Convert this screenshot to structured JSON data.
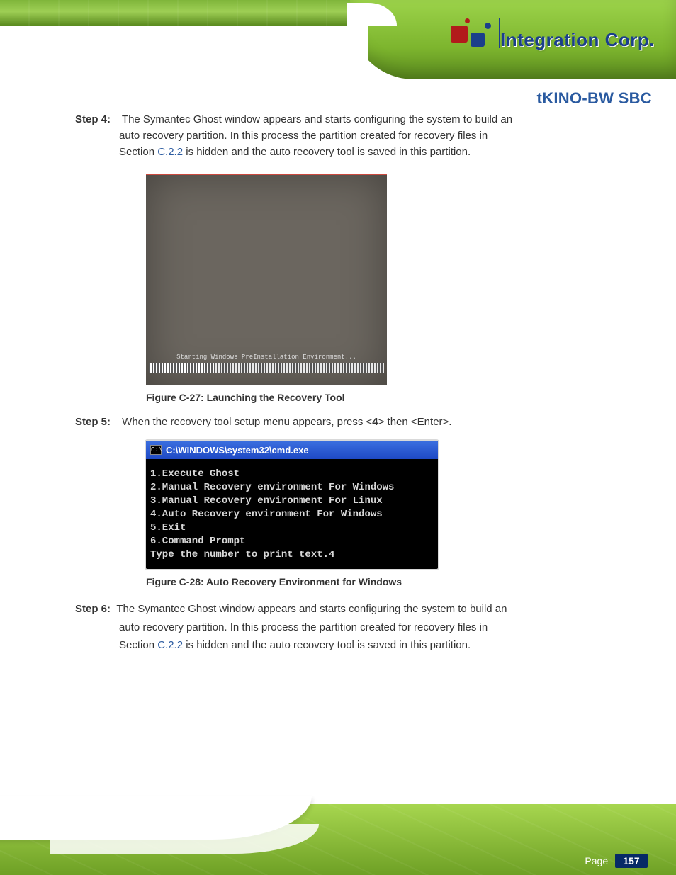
{
  "brand": {
    "name": "Integration Corp."
  },
  "product_label": "tKINO-BW SBC",
  "step4": {
    "no": "Step 4:",
    "line1_a": "The Symantec Ghost window appears and starts configuring the system to build an",
    "line1_b": "auto recovery partition. In this process the partition created for recovery files in",
    "line1_c_before_ref": "Section ",
    "line1_c_ref": "C.2.2",
    "line1_c_after_ref": " is hidden and the auto recovery tool is saved in this partition.",
    "fig1_msg": "Starting Windows PreInstallation Environment...",
    "caption1": "Figure C-27: Launching the Recovery Tool",
    "no5": "Step 5:",
    "line5_a": "When the recovery tool setup menu appears, press <",
    "line5_key": "4",
    "line5_b": "> then <Enter>.",
    "cmd_title": "C:\\WINDOWS\\system32\\cmd.exe",
    "cmd_icon": "C:\\",
    "cmd_body": "1.Execute Ghost\n2.Manual Recovery environment For Windows\n3.Manual Recovery environment For Linux\n4.Auto Recovery environment For Windows\n5.Exit\n6.Command Prompt\nType the number to print text.4",
    "caption2": "Figure C-28: Auto Recovery Environment for Windows",
    "no6": "Step 6:",
    "para6_a": "The Symantec Ghost window appears and starts configuring the system to build an",
    "para6_b": "auto recovery partition. In this process the partition created for recovery files in",
    "para6_c_before_ref": "Section ",
    "para6_c_ref": "C.2.2",
    "para6_c_after_ref": " is hidden and the auto recovery tool is saved in this partition."
  },
  "page": {
    "label": "Page",
    "number": "157"
  }
}
